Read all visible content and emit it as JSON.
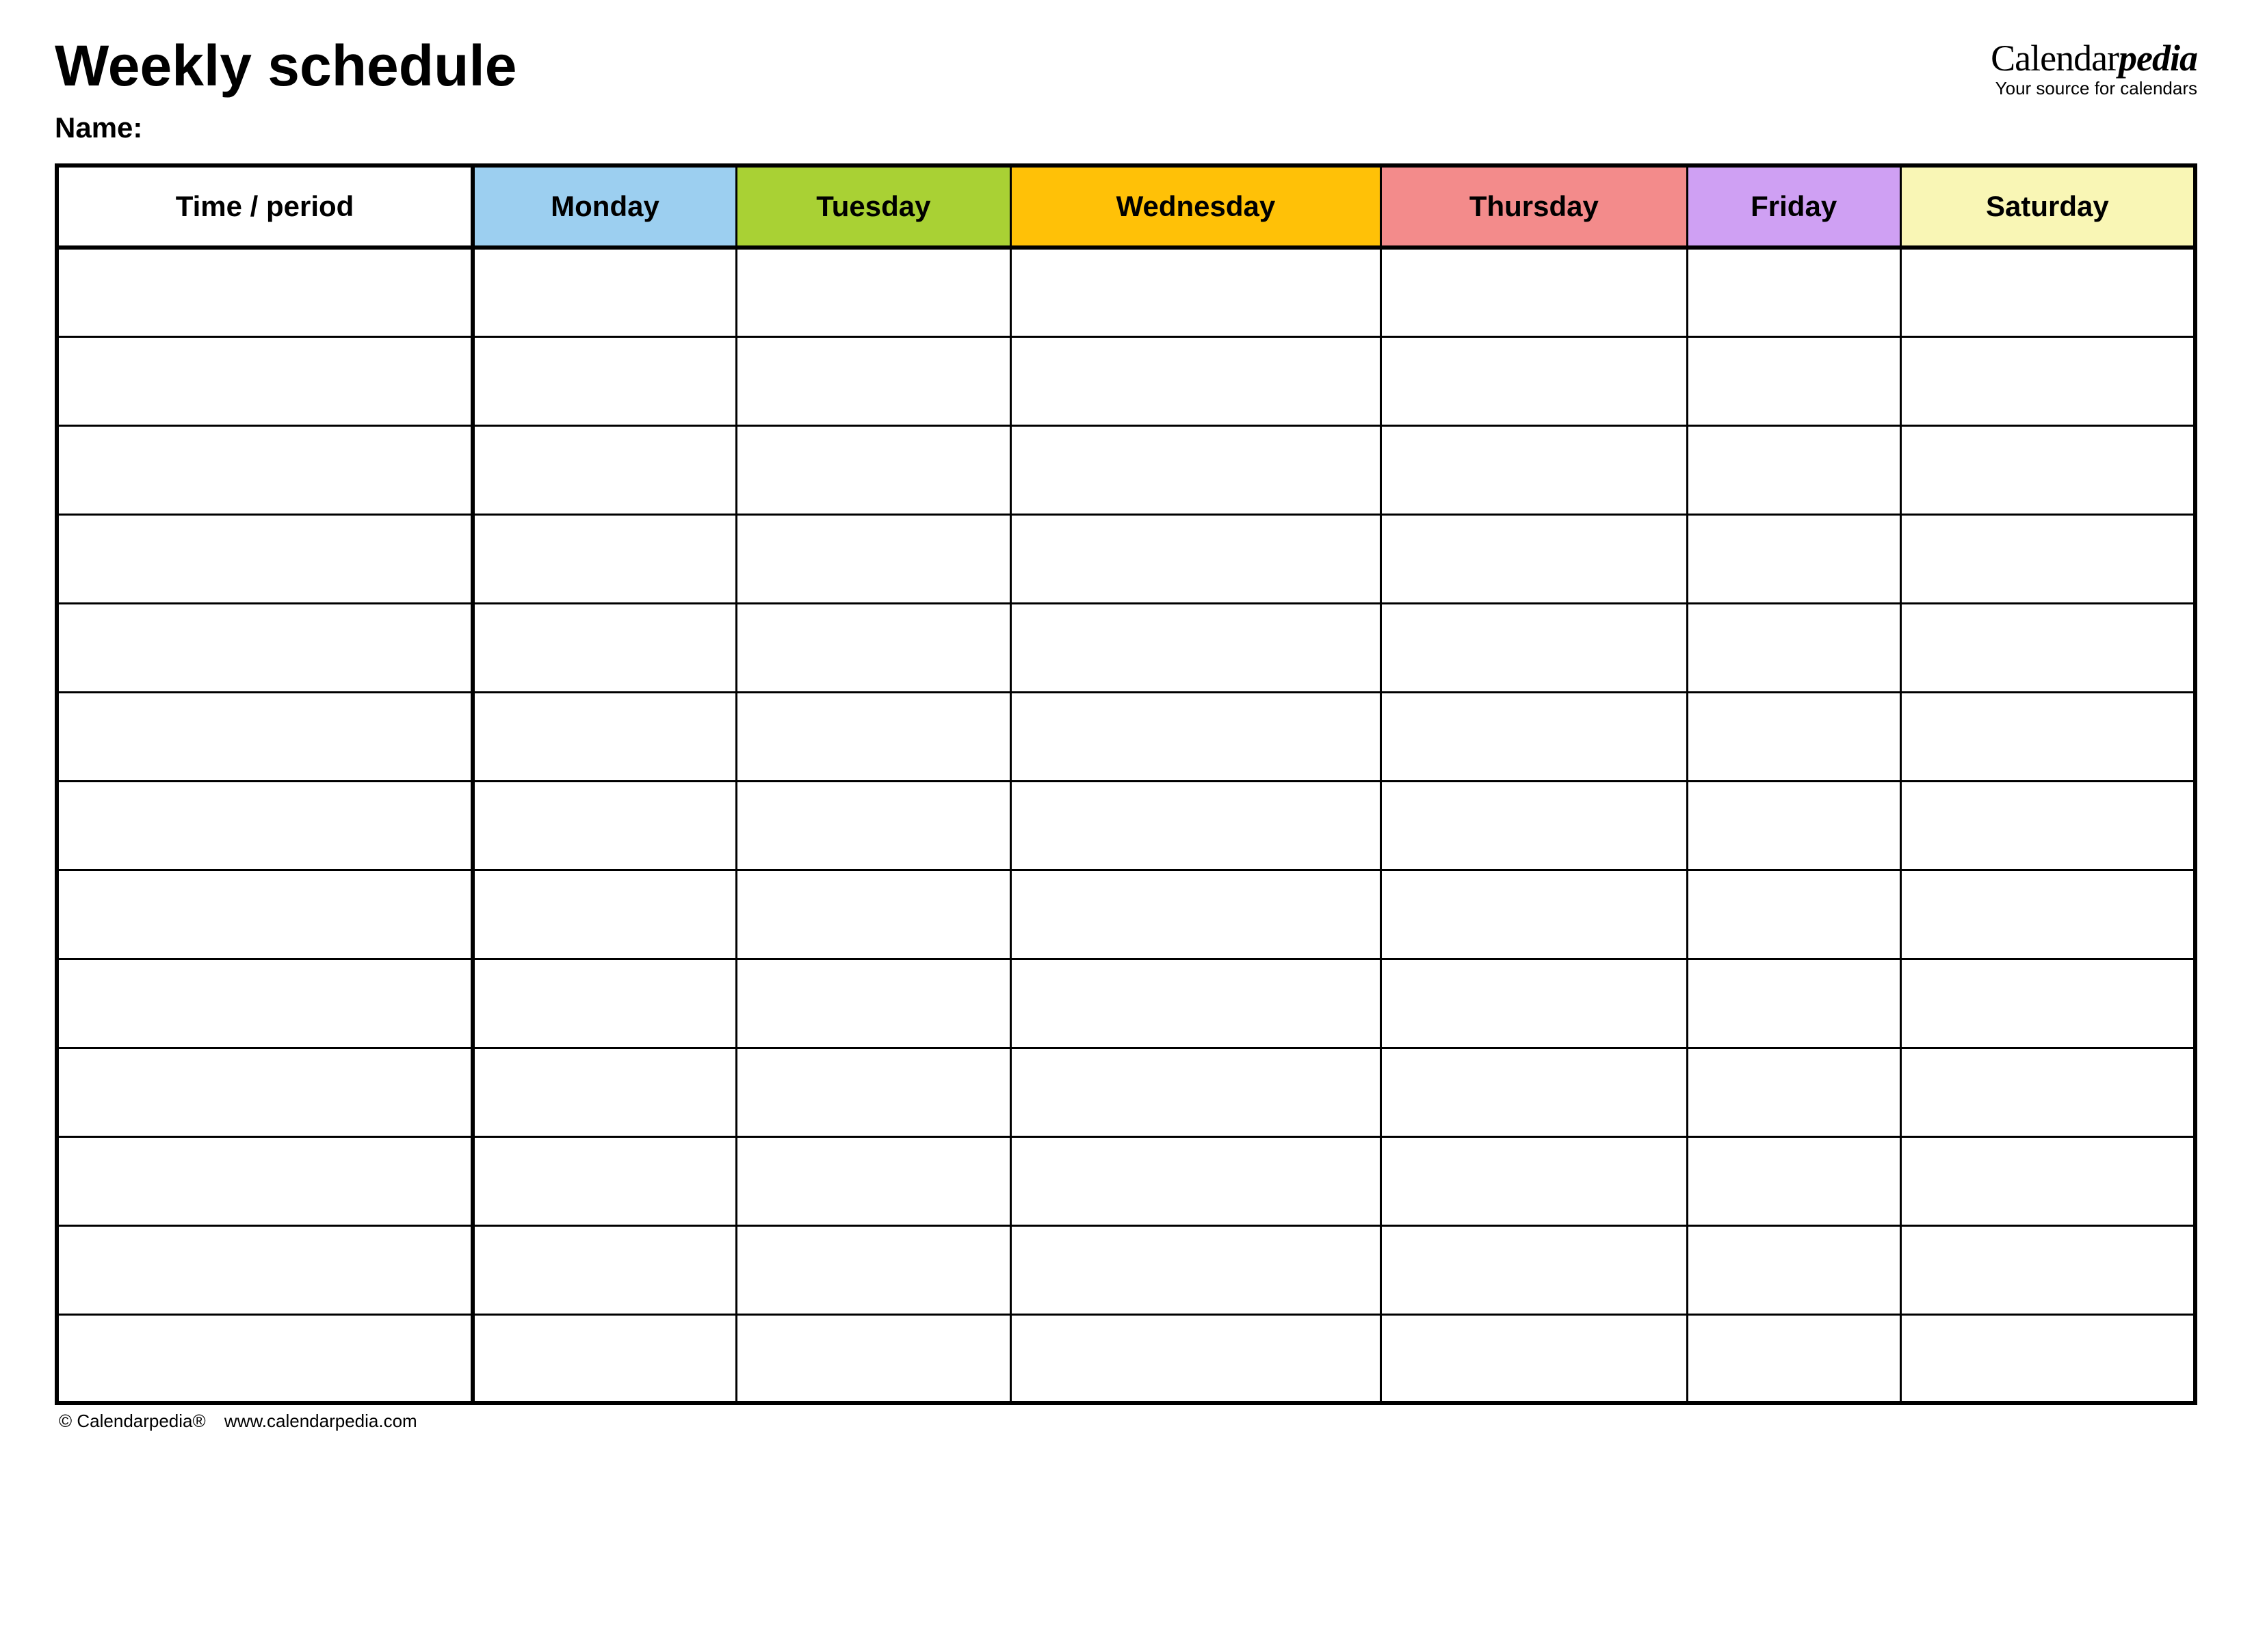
{
  "title": "Weekly schedule",
  "brand": {
    "part1": "Calendar",
    "part2": "pedia",
    "tagline": "Your source for calendars"
  },
  "name": {
    "label": "Name:",
    "value": ""
  },
  "columns": [
    {
      "label": "Time / period",
      "bg": "#ffffff"
    },
    {
      "label": "Monday",
      "bg": "#9ccff0"
    },
    {
      "label": "Tuesday",
      "bg": "#a9d134"
    },
    {
      "label": "Wednesday",
      "bg": "#ffc107"
    },
    {
      "label": "Thursday",
      "bg": "#f38b8b"
    },
    {
      "label": "Friday",
      "bg": "#cfa0f3"
    },
    {
      "label": "Saturday",
      "bg": "#f9f6b5"
    }
  ],
  "rows": 13,
  "cells": [
    [
      "",
      "",
      "",
      "",
      "",
      "",
      ""
    ],
    [
      "",
      "",
      "",
      "",
      "",
      "",
      ""
    ],
    [
      "",
      "",
      "",
      "",
      "",
      "",
      ""
    ],
    [
      "",
      "",
      "",
      "",
      "",
      "",
      ""
    ],
    [
      "",
      "",
      "",
      "",
      "",
      "",
      ""
    ],
    [
      "",
      "",
      "",
      "",
      "",
      "",
      ""
    ],
    [
      "",
      "",
      "",
      "",
      "",
      "",
      ""
    ],
    [
      "",
      "",
      "",
      "",
      "",
      "",
      ""
    ],
    [
      "",
      "",
      "",
      "",
      "",
      "",
      ""
    ],
    [
      "",
      "",
      "",
      "",
      "",
      "",
      ""
    ],
    [
      "",
      "",
      "",
      "",
      "",
      "",
      ""
    ],
    [
      "",
      "",
      "",
      "",
      "",
      "",
      ""
    ],
    [
      "",
      "",
      "",
      "",
      "",
      "",
      ""
    ]
  ],
  "footer": {
    "copyright": "© Calendarpedia®",
    "url": "www.calendarpedia.com"
  }
}
